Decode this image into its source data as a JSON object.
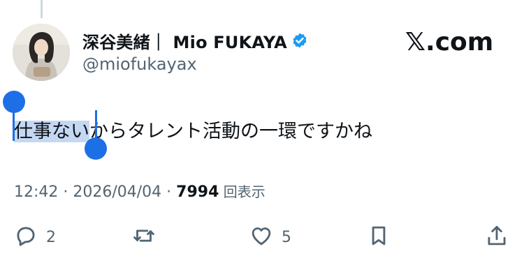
{
  "tweet": {
    "display_name": "深谷美緒｜ Mio FUKAYA",
    "handle": "@miofukayax",
    "brand": ".com",
    "brand_x": "𝕏",
    "text_selected": "仕事ない",
    "text_rest": "からタレント活動の一環ですかね",
    "meta_prefix": "12:42 · 2026/04/04 · ",
    "views": "7994",
    "views_label": " 回表示"
  },
  "actions": {
    "reply_count": "2",
    "like_count": "5"
  },
  "icons": {
    "verified": "verified-badge-icon",
    "reply": "reply-icon",
    "retweet": "retweet-icon",
    "like": "heart-icon",
    "bookmark": "bookmark-icon",
    "share": "share-icon"
  },
  "colors": {
    "accent": "#1d9bf0",
    "selection_handle": "#1d6fe6",
    "selection_bg": "#c5d8f3",
    "secondary_text": "#536471"
  }
}
